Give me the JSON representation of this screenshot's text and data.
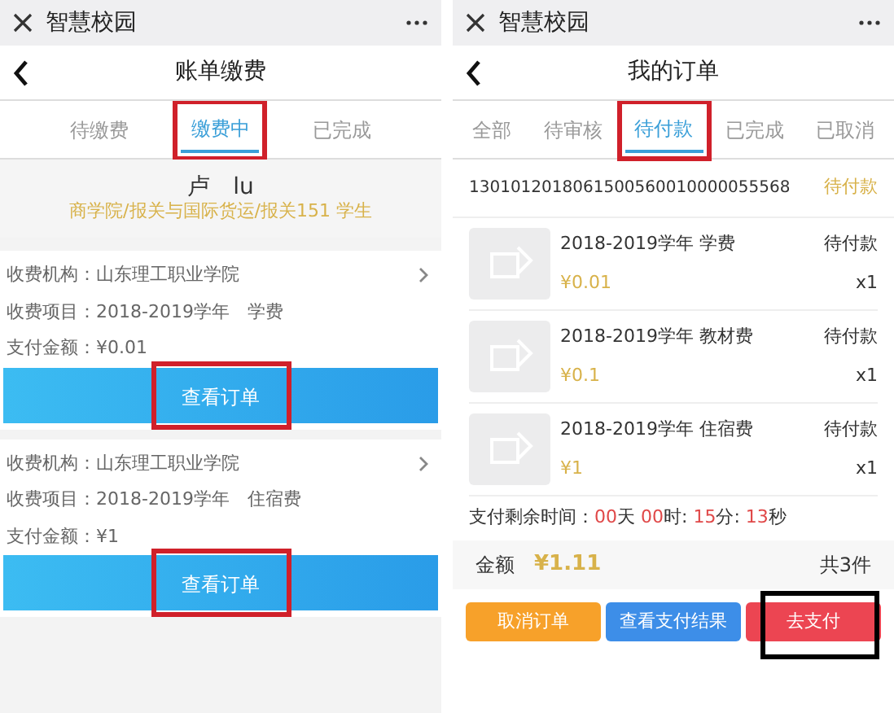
{
  "panels": [
    {
      "kind": "bills",
      "app_title": "智慧校园",
      "page_title": "账单缴费",
      "tabs": [
        {
          "label": "待缴费",
          "selected": false
        },
        {
          "label": "缴费中",
          "selected": true,
          "color": "#d0202a"
        },
        {
          "label": "已完成",
          "selected": false
        }
      ],
      "student": {
        "name": "卢　lu",
        "info": "商学院/报关与国际货运/报关151 学生"
      },
      "bills": [
        {
          "institution": "收费机构：山东理工职业学院",
          "item": "收费项目：2018-2019学年　学费",
          "amount": "支付金额：¥0.01",
          "button": "查看订单",
          "color": "#d0202a"
        },
        {
          "institution": "收费机构：山东理工职业学院",
          "item": "收费项目：2018-2019学年　住宿费",
          "amount": "支付金额：¥1",
          "button": "查看订单",
          "color": "#d0202a"
        }
      ]
    },
    {
      "kind": "orders",
      "app_title": "智慧校园",
      "page_title": "我的订单",
      "tabs": [
        {
          "label": "全部",
          "selected": false
        },
        {
          "label": "待审核",
          "selected": false
        },
        {
          "label": "待付款",
          "selected": true,
          "color": "#d0202a"
        },
        {
          "label": "已完成",
          "selected": false
        },
        {
          "label": "已取消",
          "selected": false
        }
      ],
      "order_number": "1301012018061500560010000055568",
      "order_status": "待付款",
      "items": [
        {
          "name": "2018-2019学年 学费",
          "status": "待付款",
          "price": "¥0.01",
          "quantity": "x1"
        },
        {
          "name": "2018-2019学年 教材费",
          "status": "待付款",
          "price": "¥0.1",
          "quantity": "x1"
        },
        {
          "name": "2018-2019学年 住宿费",
          "status": "待付款",
          "price": "¥1",
          "quantity": "x1"
        }
      ],
      "countdown_label": "支付剩余时间：",
      "countdown": [
        {
          "value": "00",
          "unit": "天 "
        },
        {
          "value": "00",
          "unit": "时: "
        },
        {
          "value": "15",
          "unit": "分: "
        },
        {
          "value": "13",
          "unit": "秒"
        }
      ],
      "amount_label": "金额",
      "amount": "¥1.11",
      "count": "共3件",
      "actions": [
        {
          "label": "取消订单",
          "kind": "cancel"
        },
        {
          "label": "查看支付结果",
          "kind": "result"
        },
        {
          "label": "去支付",
          "kind": "pay",
          "color": "#000000"
        }
      ]
    }
  ]
}
